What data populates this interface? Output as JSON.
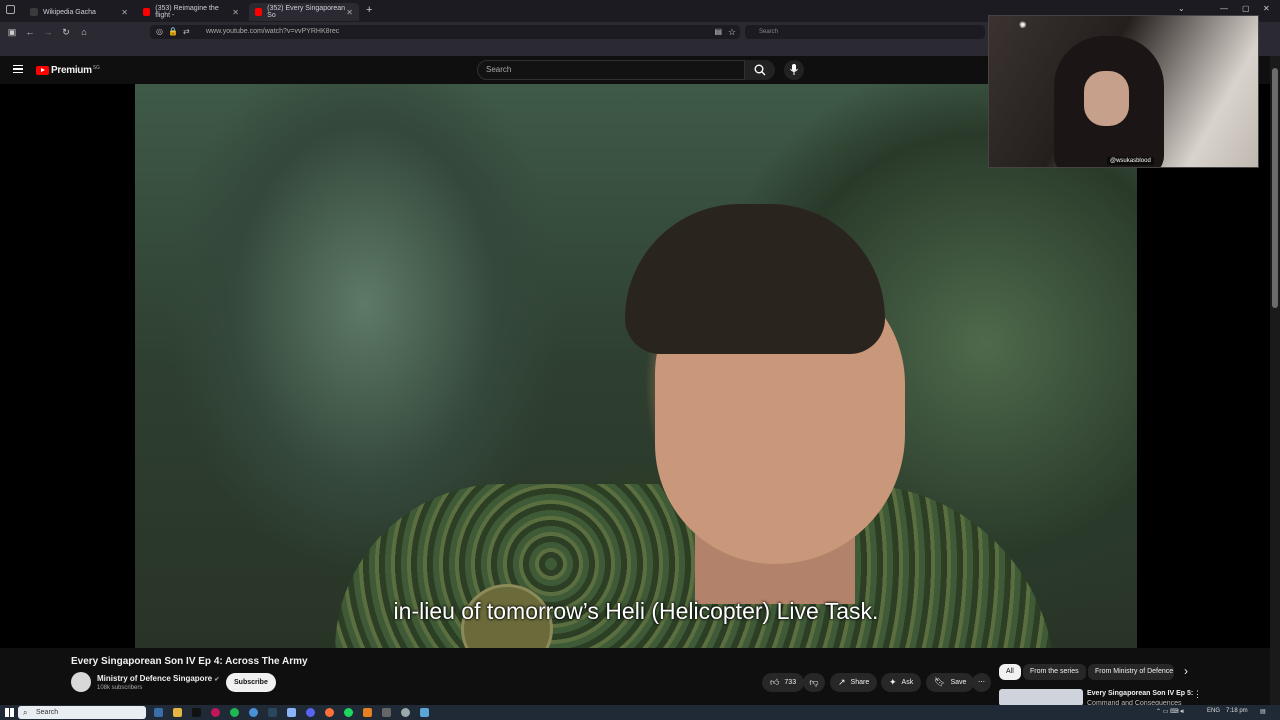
{
  "browser": {
    "tabs": [
      {
        "label": "Wikipedia Gacha",
        "active": false,
        "color": "#3a3a3a"
      },
      {
        "label": "(353) Reimagine the flight -",
        "active": false,
        "color": "#ff0000"
      },
      {
        "label": "(352) Every Singaporean So",
        "active": true,
        "color": "#ff0000"
      }
    ],
    "new_tab": "+",
    "url": "www.youtube.com/watch?v=vvPYRHK8rec",
    "search_placeholder": "Search"
  },
  "youtube": {
    "logo_text": "Premium",
    "logo_region": "SG",
    "search_placeholder": "Search"
  },
  "video": {
    "subtitle": "in-lieu of tomorrow’s Heli (Helicopter) Live Task.",
    "title": "Every Singaporean Son IV Ep 4: Across The Army"
  },
  "webcam": {
    "handle": "@wsukasblood"
  },
  "channel": {
    "name": "Ministry of Defence Singapore",
    "verified": "✔",
    "subscribers": "108k subscribers",
    "subscribe_label": "Subscribe"
  },
  "actions": {
    "likes": "733",
    "share": "Share",
    "ask": "Ask",
    "save": "Save",
    "more": "⋯"
  },
  "related": {
    "chips": [
      "All",
      "From the series",
      "From Ministry of Defence"
    ],
    "next_arrow": "›",
    "first_title": "Every Singaporean Son IV Ep 5:",
    "first_sub": "Command and Consequences",
    "first_menu": "⋮"
  },
  "taskbar": {
    "search_placeholder": "Search",
    "lang": "ENG",
    "time": "7:18 pm"
  },
  "colors": {
    "youtube_red": "#ff0000",
    "page_bg": "#0f0f0f"
  }
}
